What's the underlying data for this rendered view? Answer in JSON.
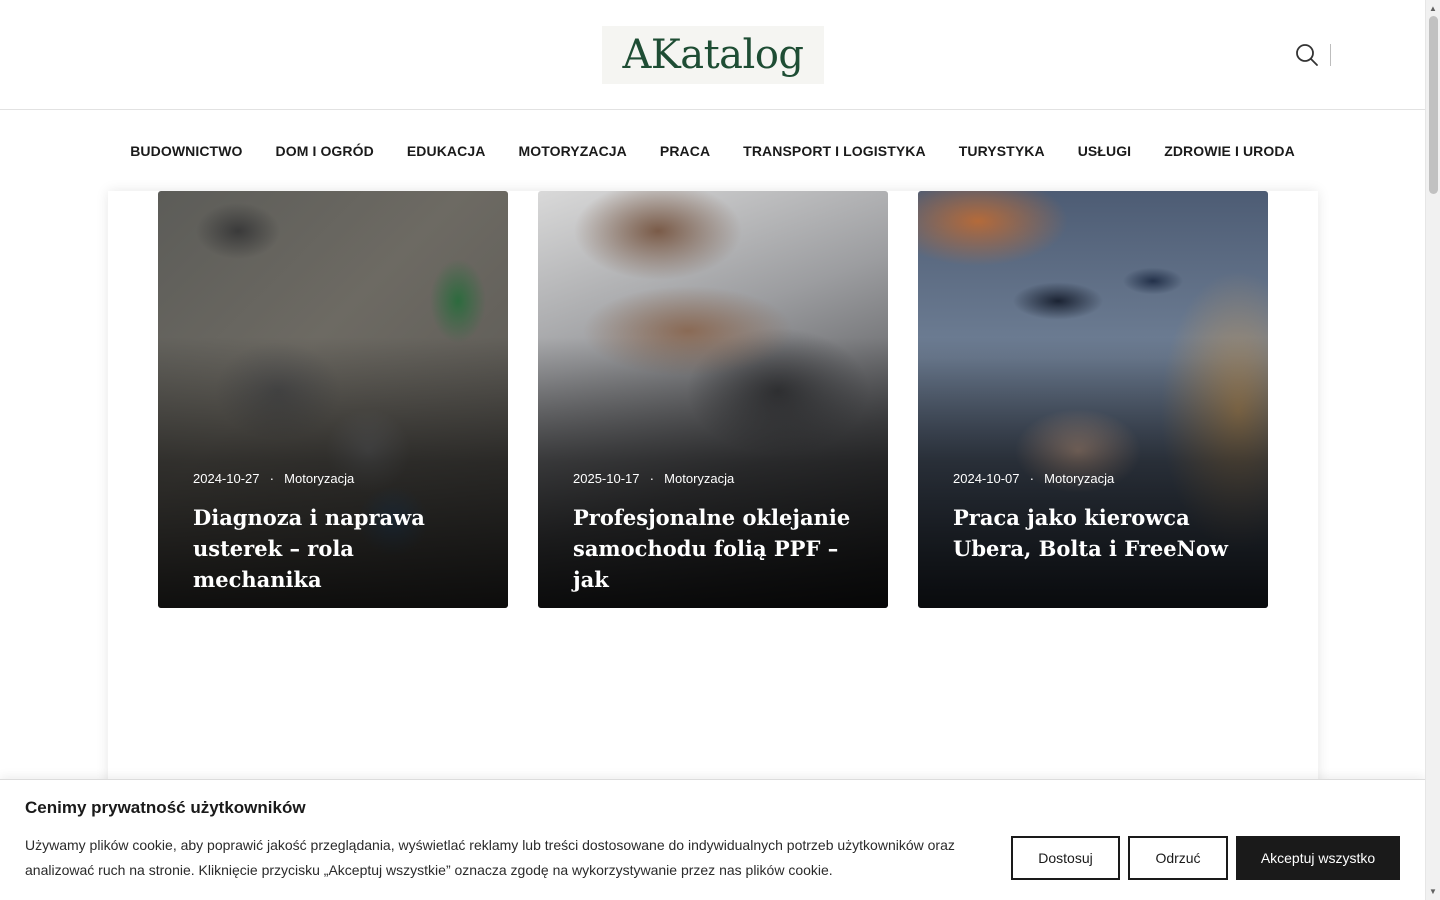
{
  "header": {
    "logo_text": "AKatalog",
    "search_icon": "search-icon"
  },
  "nav": {
    "items": [
      {
        "label": "BUDOWNICTWO"
      },
      {
        "label": "DOM I OGRÓD"
      },
      {
        "label": "EDUKACJA"
      },
      {
        "label": "MOTORYZACJA"
      },
      {
        "label": "PRACA"
      },
      {
        "label": "TRANSPORT I LOGISTYKA"
      },
      {
        "label": "TURYSTYKA"
      },
      {
        "label": "USŁUGI"
      },
      {
        "label": "ZDROWIE I URODA"
      }
    ]
  },
  "posts": [
    {
      "date": "2024-10-27",
      "category": "Motoryzacja",
      "title": "Diagnoza i naprawa usterek – rola mechanika"
    },
    {
      "date": "2025-10-17",
      "category": "Motoryzacja",
      "title": "Profesjonalne oklejanie samochodu folią PPF – jak"
    },
    {
      "date": "2024-10-07",
      "category": "Motoryzacja",
      "title": "Praca jako kierowca Ubera, Bolta i FreeNow"
    }
  ],
  "cookie": {
    "title": "Cenimy prywatność użytkowników",
    "text": "Używamy plików cookie, aby poprawić jakość przeglądania, wyświetlać reklamy lub treści dostosowane do indywidualnych potrzeb użytkowników oraz analizować ruch na stronie. Kliknięcie przycisku „Akceptuj wszystkie” oznacza zgodę na wykorzystywanie przez nas plików cookie.",
    "customize_label": "Dostosuj",
    "reject_label": "Odrzuć",
    "accept_label": "Akceptuj wszystko"
  },
  "colors": {
    "logo_green": "#1e4d34",
    "button_dark": "#1a1a1a"
  }
}
